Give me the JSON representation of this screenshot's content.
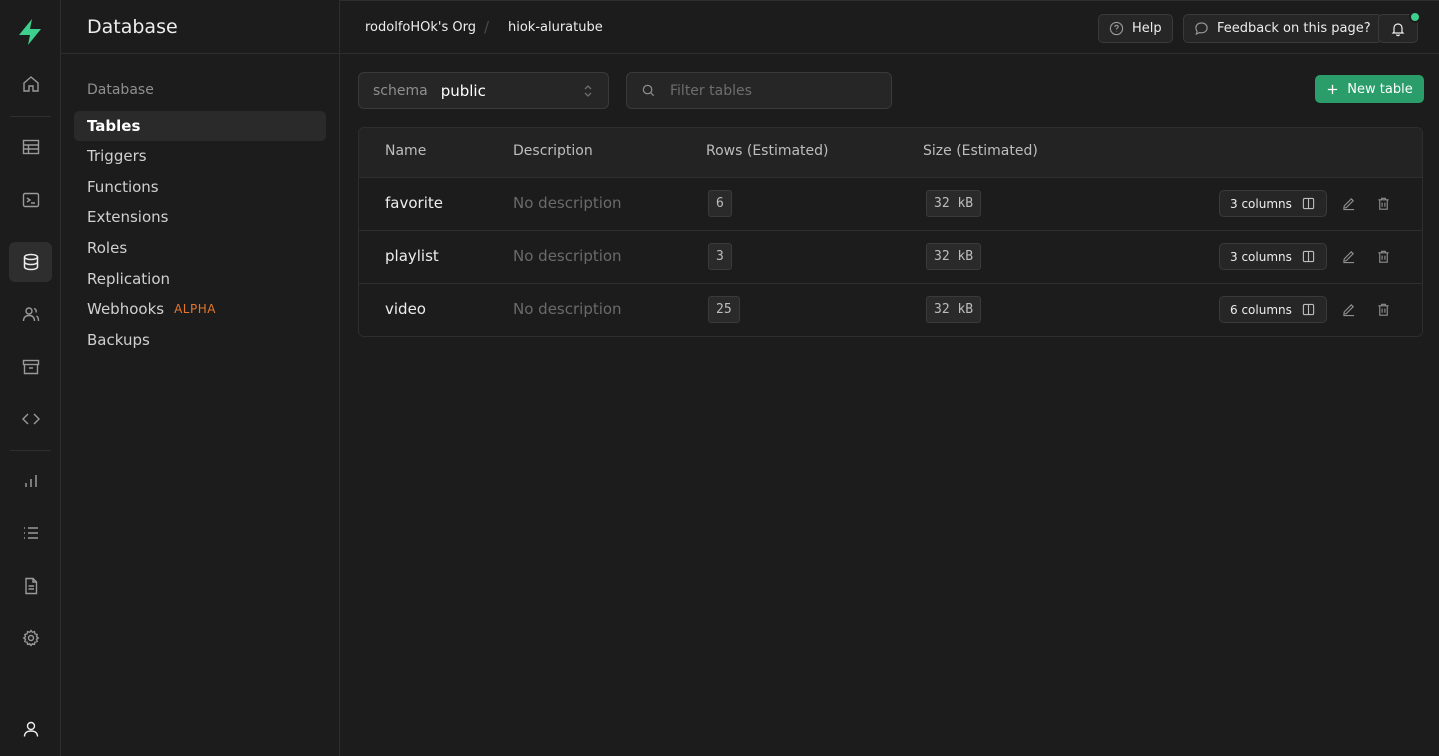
{
  "colors": {
    "accent": "#3ecf8e",
    "alpha_badge": "#e4762c"
  },
  "rail": {
    "items": [
      "home-icon",
      "table-editor-icon",
      "sql-editor-icon",
      "database-icon",
      "auth-icon",
      "storage-icon",
      "edge-functions-icon",
      "reports-icon",
      "logs-icon",
      "api-docs-icon",
      "settings-icon",
      "account-icon"
    ]
  },
  "sidebar": {
    "title": "Database",
    "group_label": "Database",
    "items": [
      {
        "label": "Tables"
      },
      {
        "label": "Triggers"
      },
      {
        "label": "Functions"
      },
      {
        "label": "Extensions"
      },
      {
        "label": "Roles"
      },
      {
        "label": "Replication"
      },
      {
        "label": "Webhooks",
        "badge": "ALPHA"
      },
      {
        "label": "Backups"
      }
    ]
  },
  "topbar": {
    "org": "rodolfoHOk's Org",
    "separator": "/",
    "project": "hiok-aluratube",
    "help_label": "Help",
    "feedback_label": "Feedback on this page?"
  },
  "toolbar": {
    "schema_label": "schema",
    "schema_value": "public",
    "filter_placeholder": "Filter tables",
    "new_table_label": "New table"
  },
  "table": {
    "headers": [
      "Name",
      "Description",
      "Rows (Estimated)",
      "Size (Estimated)"
    ],
    "rows": [
      {
        "name": "favorite",
        "description": "No description",
        "rows": "6",
        "size": "32 kB",
        "columns": "3 columns"
      },
      {
        "name": "playlist",
        "description": "No description",
        "rows": "3",
        "size": "32 kB",
        "columns": "3 columns"
      },
      {
        "name": "video",
        "description": "No description",
        "rows": "25",
        "size": "32 kB",
        "columns": "6 columns"
      }
    ]
  }
}
